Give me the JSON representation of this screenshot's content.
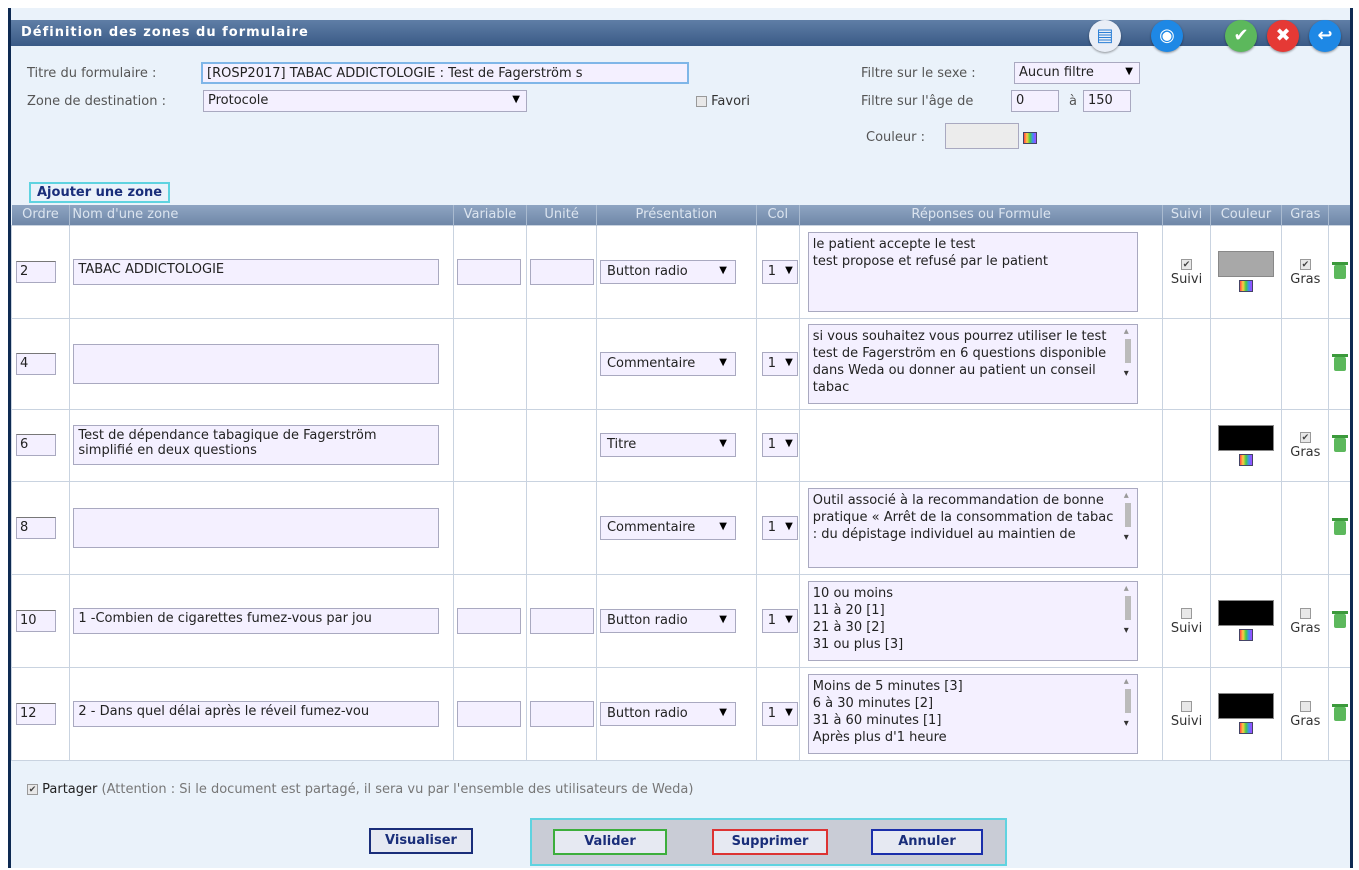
{
  "window": {
    "title": "Définition des zones du formulaire"
  },
  "top_icons": [
    {
      "name": "document-icon",
      "color": "#2b7fd6",
      "glyph": "▤"
    },
    {
      "name": "search-icon",
      "color": "#1e88e5",
      "glyph": "◉"
    },
    {
      "name": "check-icon",
      "color": "#4caf50",
      "glyph": "✔"
    },
    {
      "name": "close-icon",
      "color": "#e53935",
      "glyph": "✖"
    },
    {
      "name": "back-icon",
      "color": "#1e88e5",
      "glyph": "↩"
    }
  ],
  "form": {
    "title_label": "Titre du formulaire :",
    "title_value": "[ROSP2017] TABAC ADDICTOLOGIE : Test de Fagerström s",
    "dest_label": "Zone de destination :",
    "dest_value": "Protocole",
    "favori_label": "Favori",
    "sex_filter_label": "Filtre sur le sexe :",
    "sex_filter_value": "Aucun filtre",
    "age_filter_label": "Filtre sur l'âge de",
    "age_from": "0",
    "age_to_label": "à",
    "age_to": "150",
    "color_label": "Couleur :"
  },
  "add_zone_label": "Ajouter une zone",
  "columns": [
    "Ordre",
    "Nom d'une zone",
    "Variable",
    "Unité",
    "Présentation",
    "Col",
    "Réponses ou Formule",
    "Suivi",
    "Couleur",
    "Gras",
    ""
  ],
  "rows": [
    {
      "order": "2",
      "name": "TABAC ADDICTOLOGIE",
      "presentation": "Button radio",
      "col": "1",
      "responses": "le patient accepte le test\ntest propose et refusé par le patient",
      "suivi": "Suivi",
      "gras": "Gras",
      "color": "#a8a8a8"
    },
    {
      "order": "4",
      "name": "",
      "presentation": "Commentaire",
      "col": "1",
      "responses": "si vous souhaitez vous pourrez utiliser le test  test de Fagerström en 6 questions disponible dans Weda ou donner au patient un conseil tabac"
    },
    {
      "order": "6",
      "name": "Test de dépendance tabagique de Fagerström simplifié en deux questions",
      "presentation": "Titre",
      "col": "1",
      "gras": "Gras",
      "color": "#000000"
    },
    {
      "order": "8",
      "name": "",
      "presentation": "Commentaire",
      "col": "1",
      "responses": "Outil associé à la recommandation de bonne pratique « Arrêt de la consommation de tabac : du dépistage individuel au maintien de"
    },
    {
      "order": "10",
      "name": "1 -Combien de cigarettes fumez-vous par jou",
      "presentation": "Button radio",
      "col": "1",
      "responses": "10 ou moins\n11 à 20 [1]\n21 à 30 [2]\n31 ou plus [3]",
      "suivi": "Suivi",
      "gras": "Gras",
      "color": "#000000"
    },
    {
      "order": "12",
      "name": "2 - Dans quel délai après le réveil fumez-vou",
      "presentation": "Button radio",
      "col": "1",
      "responses": "Moins de 5 minutes [3]\n6 à 30 minutes [2]\n31 à 60 minutes [1]\nAprès plus d'1 heure",
      "suivi": "Suivi",
      "gras": "Gras",
      "color": "#000000"
    }
  ],
  "footer": {
    "share_label": "Partager",
    "share_note": "(Attention : Si le document est partagé, il sera vu par l'ensemble des utilisateurs de Weda)",
    "visualiser": "Visualiser",
    "valider": "Valider",
    "supprimer": "Supprimer",
    "annuler": "Annuler"
  }
}
